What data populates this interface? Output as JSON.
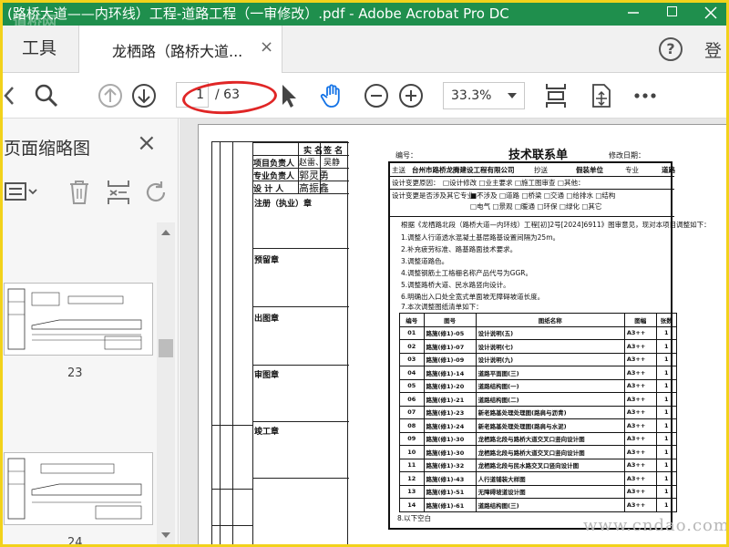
{
  "window": {
    "title": "(路桥大道——内环线）工程-道路工程（一审修改）.pdf - Adobe Acrobat Pro DC",
    "logo_text": "道桥网"
  },
  "tabs": {
    "tools_label": "工具",
    "doc_label": "龙栖路（路桥大道...",
    "close": "×",
    "help": "?",
    "login_label": "登"
  },
  "toolbar": {
    "current_page": "1",
    "total_pages": "/ 63",
    "zoom": "33.3%",
    "icons": [
      "print-icon",
      "search-icon",
      "page-up-icon",
      "page-down-icon",
      "select-cursor-icon",
      "hand-tool-icon",
      "zoom-out-icon",
      "zoom-in-icon",
      "fit-page-icon",
      "rotate-page-icon",
      "more-icon"
    ]
  },
  "panel": {
    "title": "页面缩略图",
    "close": "×",
    "thumbs": [
      {
        "label": "23"
      },
      {
        "label": "24"
      }
    ]
  },
  "document": {
    "stamp": {
      "head_real": "实 名",
      "head_sign": "签 名",
      "role1": "项目负责人",
      "name1": "赵雷、吴静",
      "role2": "专业负责人",
      "name2": "郭灵勇",
      "role3": "设 计 人",
      "name3": "高振鑫",
      "reg_stamp": "注册（执业）章",
      "pre_stamp": "预留章",
      "out_stamp": "出图章",
      "review_stamp": "审图章",
      "complete_stamp": "竣工章"
    },
    "sheet": {
      "title": "技术联系单",
      "code_label": "编号：",
      "date_label": "修改日期：",
      "to_label": "主送",
      "to_value": "台州市路桥龙腾建设工程有限公司",
      "cc_label": "抄送",
      "cc_value": "假装单位",
      "spec_label": "专业",
      "spec_value": "道路",
      "change_label": "设计变更原因：",
      "change_opts": "□设计修改  □业主要求  □施工图审查  □其他：",
      "scope_label": "设计变更是否涉及其它专业：",
      "scope_opts": "■不涉及 □道路 □桥梁 □交通 □给排水 □结构",
      "scope_opts2": "□电气 □景观 □暖通 □环保 □绿化 □其它",
      "notes": [
        "根据《龙栖路北段（路桥大道—内环线）工程[初]2号[2024]6911》图审意见，现对本项目调整如下：",
        "1.调整人行道透水混凝土基层路基设置间隔为25m。",
        "2.补充疲劳标准、路基路面技术要求。",
        "3.调整道路色。",
        "4.调整钢筋土工格栅名称产品代号为GGR。",
        "5.调整路桥大道、民水路竖向设计。",
        "6.明确出入口处全宽式单面坡无障碍坡道长度。",
        "7.本次调整图纸清单如下："
      ],
      "columns": [
        "编号",
        "图号",
        "图纸名称",
        "图幅",
        "张数"
      ],
      "rows": [
        [
          "01",
          "路施(修1)-05",
          "设计说明(五)",
          "A3++",
          "1"
        ],
        [
          "02",
          "路施(修1)-07",
          "设计说明(七)",
          "A3++",
          "1"
        ],
        [
          "03",
          "路施(修1)-09",
          "设计说明(九)",
          "A3++",
          "1"
        ],
        [
          "04",
          "路施(修1)-14",
          "道路平面图(三)",
          "A3++",
          "1"
        ],
        [
          "05",
          "路施(修1)-20",
          "道路结构图(一)",
          "A3++",
          "1"
        ],
        [
          "06",
          "路施(修1)-21",
          "道路结构图(二)",
          "A3++",
          "1"
        ],
        [
          "07",
          "路施(修1)-23",
          "新老路基处理处理图(路肩与沥青)",
          "A3++",
          "1"
        ],
        [
          "08",
          "路施(修1)-24",
          "新老路基处理处理图(路肩与水泥)",
          "A3++",
          "1"
        ],
        [
          "09",
          "路施(修1)-30",
          "龙栖路北段与路桥大道交叉口竖向设计图",
          "A3++",
          "1"
        ],
        [
          "10",
          "路施(修1)-30",
          "龙栖路北段与路桥大道交叉口竖向设计图",
          "A3++",
          "1"
        ],
        [
          "11",
          "路施(修1)-32",
          "龙栖路北段与民水路交叉口竖向设计图",
          "A3++",
          "1"
        ],
        [
          "12",
          "路施(修1)-43",
          "人行道铺装大样图",
          "A3++",
          "1"
        ],
        [
          "13",
          "路施(修1)-51",
          "无障碍坡道设计图",
          "A3++",
          "1"
        ],
        [
          "14",
          "路施(修1)-61",
          "道路结构图(三)",
          "A3++",
          "1"
        ]
      ],
      "footer": "8.以下空白"
    }
  },
  "watermark": "www.cndao.com",
  "colors": {
    "titlebar": "#1f8f4d",
    "highlight_ellipse": "#e02626",
    "frame": "#f2d21b"
  }
}
